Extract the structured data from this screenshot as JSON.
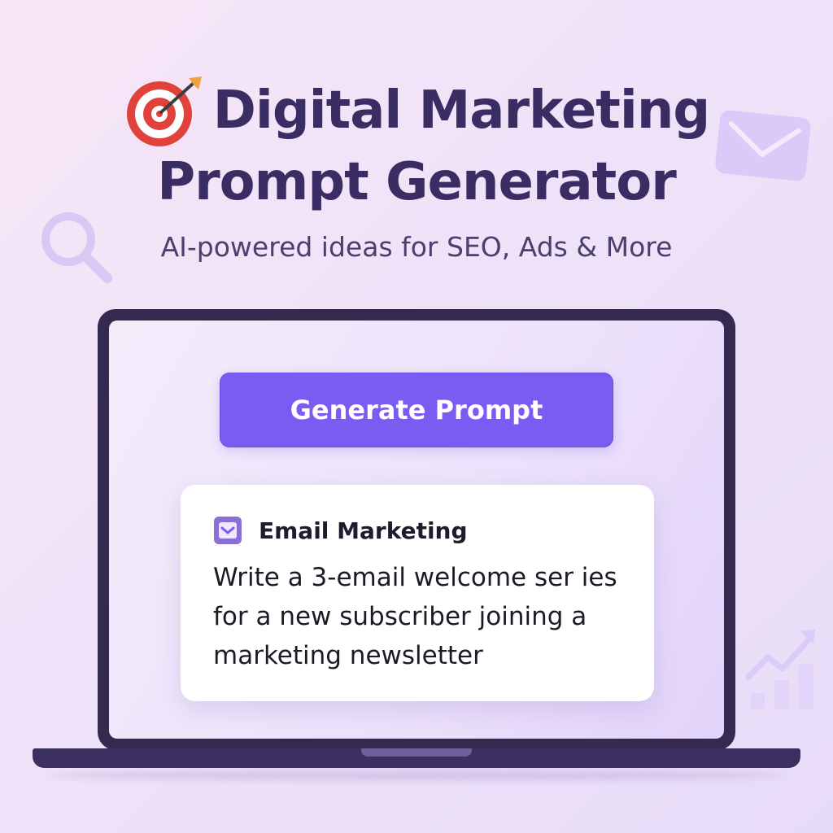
{
  "header": {
    "title_line1": "Digital Marketing",
    "title_line2": "Prompt Generator",
    "title_icon": "target-icon",
    "subtitle": "AI-powered ideas for SEO, Ads & More"
  },
  "decorations": {
    "left_icon": "search-icon",
    "top_right_icon": "envelope-icon",
    "bottom_right_icon": "growth-chart-icon"
  },
  "app": {
    "generate_button_label": "Generate Prompt",
    "card": {
      "icon": "mail-icon",
      "category": "Email Marketing",
      "text": "Write a 3-email welcome ser ies\nfor a new subscriber joining a\nmarketing newsletter"
    }
  },
  "colors": {
    "title": "#3a2d63",
    "accent": "#7a5cf2",
    "laptop_frame": "#342a50",
    "card_background": "#ffffff"
  }
}
